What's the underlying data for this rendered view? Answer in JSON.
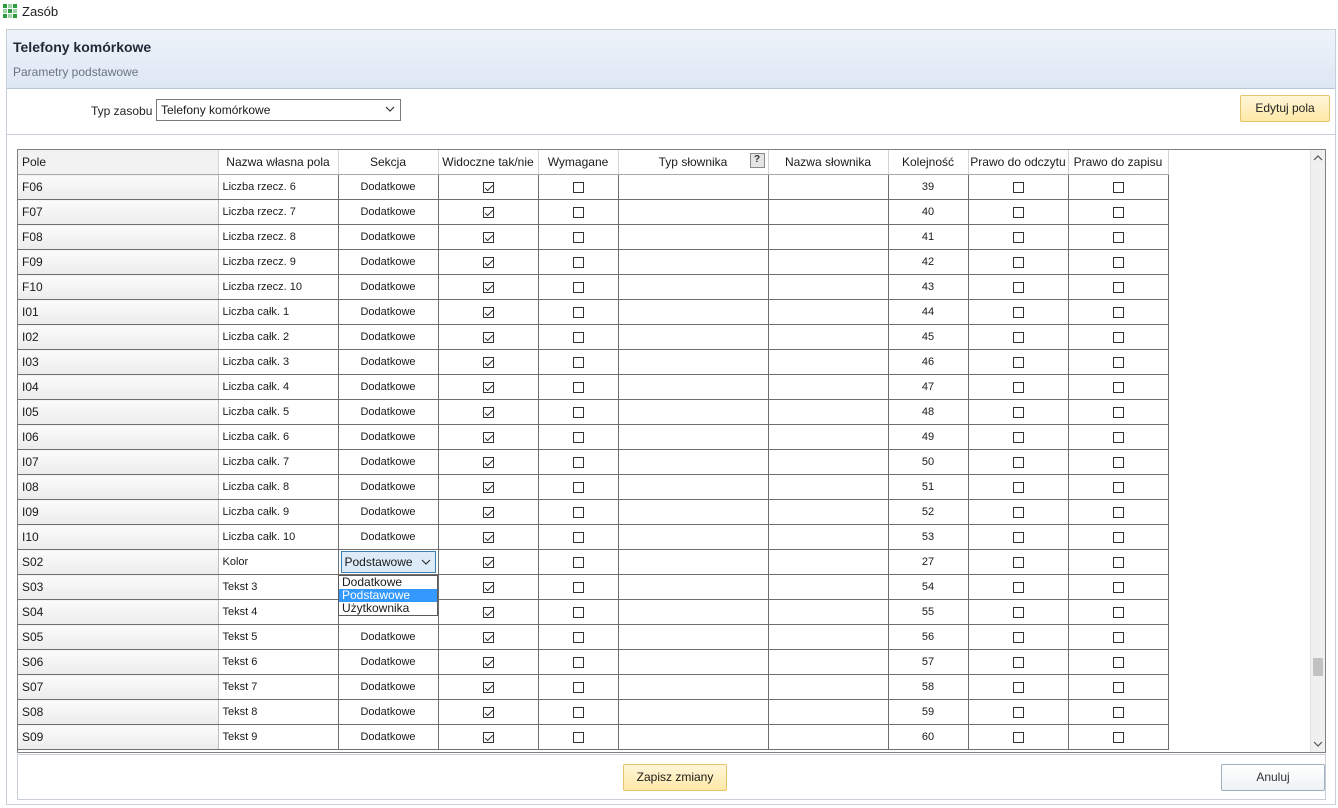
{
  "window": {
    "title": "Zasób",
    "icon": "app-grid-icon"
  },
  "header": {
    "title": "Telefony komórkowe",
    "subtitle": "Parametry podstawowe"
  },
  "toolbar": {
    "typ_label": "Typ zasobu",
    "typ_value": "Telefony komórkowe",
    "edit_button": "Edytuj pola"
  },
  "table": {
    "columns": [
      "Pole",
      "Nazwa własna pola",
      "Sekcja",
      "Widoczne tak/nie",
      "Wymagane",
      "Typ słownika",
      "Nazwa słownika",
      "Kolejność",
      "Prawo do odczytu",
      "Prawo do zapisu"
    ],
    "help_glyph": "?",
    "rows": [
      {
        "pole": "F06",
        "nazwa": "Liczba rzecz. 6",
        "sekcja": "Dodatkowe",
        "widoczne": true,
        "wymagane": false,
        "kolejnosc": "39"
      },
      {
        "pole": "F07",
        "nazwa": "Liczba rzecz. 7",
        "sekcja": "Dodatkowe",
        "widoczne": true,
        "wymagane": false,
        "kolejnosc": "40"
      },
      {
        "pole": "F08",
        "nazwa": "Liczba rzecz. 8",
        "sekcja": "Dodatkowe",
        "widoczne": true,
        "wymagane": false,
        "kolejnosc": "41"
      },
      {
        "pole": "F09",
        "nazwa": "Liczba rzecz. 9",
        "sekcja": "Dodatkowe",
        "widoczne": true,
        "wymagane": false,
        "kolejnosc": "42"
      },
      {
        "pole": "F10",
        "nazwa": "Liczba rzecz. 10",
        "sekcja": "Dodatkowe",
        "widoczne": true,
        "wymagane": false,
        "kolejnosc": "43"
      },
      {
        "pole": "I01",
        "nazwa": "Liczba całk. 1",
        "sekcja": "Dodatkowe",
        "widoczne": true,
        "wymagane": false,
        "kolejnosc": "44"
      },
      {
        "pole": "I02",
        "nazwa": "Liczba całk. 2",
        "sekcja": "Dodatkowe",
        "widoczne": true,
        "wymagane": false,
        "kolejnosc": "45"
      },
      {
        "pole": "I03",
        "nazwa": "Liczba całk. 3",
        "sekcja": "Dodatkowe",
        "widoczne": true,
        "wymagane": false,
        "kolejnosc": "46"
      },
      {
        "pole": "I04",
        "nazwa": "Liczba całk. 4",
        "sekcja": "Dodatkowe",
        "widoczne": true,
        "wymagane": false,
        "kolejnosc": "47"
      },
      {
        "pole": "I05",
        "nazwa": "Liczba całk. 5",
        "sekcja": "Dodatkowe",
        "widoczne": true,
        "wymagane": false,
        "kolejnosc": "48"
      },
      {
        "pole": "I06",
        "nazwa": "Liczba całk. 6",
        "sekcja": "Dodatkowe",
        "widoczne": true,
        "wymagane": false,
        "kolejnosc": "49"
      },
      {
        "pole": "I07",
        "nazwa": "Liczba całk. 7",
        "sekcja": "Dodatkowe",
        "widoczne": true,
        "wymagane": false,
        "kolejnosc": "50"
      },
      {
        "pole": "I08",
        "nazwa": "Liczba całk. 8",
        "sekcja": "Dodatkowe",
        "widoczne": true,
        "wymagane": false,
        "kolejnosc": "51"
      },
      {
        "pole": "I09",
        "nazwa": "Liczba całk. 9",
        "sekcja": "Dodatkowe",
        "widoczne": true,
        "wymagane": false,
        "kolejnosc": "52"
      },
      {
        "pole": "I10",
        "nazwa": "Liczba całk. 10",
        "sekcja": "Dodatkowe",
        "widoczne": true,
        "wymagane": false,
        "kolejnosc": "53"
      },
      {
        "pole": "S02",
        "nazwa": "Kolor",
        "sekcja": "Podstawowe",
        "editing": true,
        "widoczne": true,
        "wymagane": false,
        "kolejnosc": "27"
      },
      {
        "pole": "S03",
        "nazwa": "Tekst 3",
        "sekcja": "",
        "widoczne": true,
        "wymagane": false,
        "kolejnosc": "54"
      },
      {
        "pole": "S04",
        "nazwa": "Tekst 4",
        "sekcja": "",
        "widoczne": true,
        "wymagane": false,
        "kolejnosc": "55"
      },
      {
        "pole": "S05",
        "nazwa": "Tekst 5",
        "sekcja": "Dodatkowe",
        "widoczne": true,
        "wymagane": false,
        "kolejnosc": "56"
      },
      {
        "pole": "S06",
        "nazwa": "Tekst 6",
        "sekcja": "Dodatkowe",
        "widoczne": true,
        "wymagane": false,
        "kolejnosc": "57"
      },
      {
        "pole": "S07",
        "nazwa": "Tekst 7",
        "sekcja": "Dodatkowe",
        "widoczne": true,
        "wymagane": false,
        "kolejnosc": "58"
      },
      {
        "pole": "S08",
        "nazwa": "Tekst 8",
        "sekcja": "Dodatkowe",
        "widoczne": true,
        "wymagane": false,
        "kolejnosc": "59"
      },
      {
        "pole": "S09",
        "nazwa": "Tekst 9",
        "sekcja": "Dodatkowe",
        "widoczne": true,
        "wymagane": false,
        "kolejnosc": "60"
      }
    ]
  },
  "dropdown": {
    "options": [
      "Dodatkowe",
      "Podstawowe",
      "Użytkownika"
    ],
    "selected": "Podstawowe"
  },
  "footer": {
    "save_button": "Zapisz zmiany",
    "cancel_button": "Anuluj"
  }
}
